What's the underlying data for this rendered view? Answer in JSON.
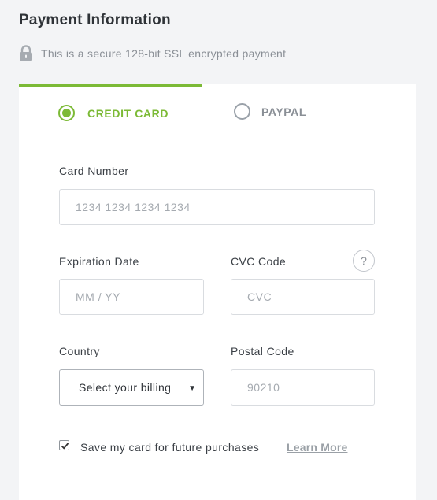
{
  "header": {
    "title": "Payment Information",
    "secure_text": "This is a secure 128-bit SSL encrypted payment"
  },
  "tabs": [
    {
      "label": "CREDIT CARD",
      "selected": true
    },
    {
      "label": "PAYPAL",
      "selected": false
    }
  ],
  "form": {
    "card_number": {
      "label": "Card Number",
      "placeholder": "1234 1234 1234 1234",
      "value": ""
    },
    "expiration": {
      "label": "Expiration Date",
      "placeholder": "MM / YY",
      "value": ""
    },
    "cvc": {
      "label": "CVC Code",
      "placeholder": "CVC",
      "value": "",
      "help_glyph": "?"
    },
    "country": {
      "label": "Country",
      "selected_text": "Select your billing country",
      "caret": "▼"
    },
    "postal": {
      "label": "Postal Code",
      "placeholder": "90210",
      "value": ""
    },
    "save_card": {
      "checked": true,
      "label": "Save my card for future purchases"
    },
    "learn_more": "Learn More"
  },
  "colors": {
    "accent": "#7cba36",
    "muted": "#8a8f96",
    "background": "#f3f4f6"
  },
  "icons": {
    "lock": "lock-icon",
    "help": "help-circle-icon",
    "checkmark": "checkmark-icon"
  }
}
